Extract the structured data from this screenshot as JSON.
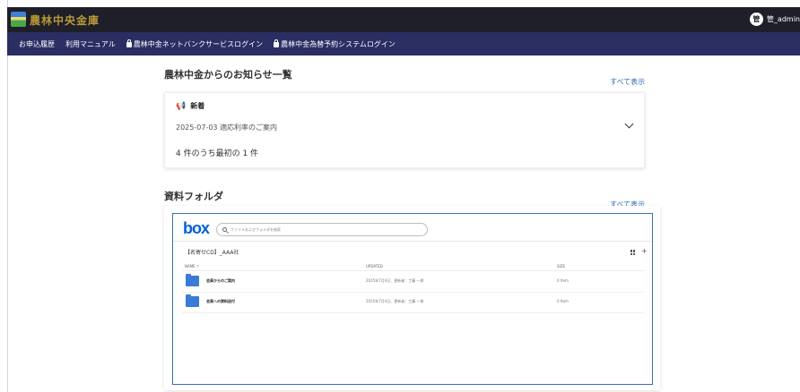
{
  "header": {
    "logo_text": "農林中央金庫",
    "user_initial": "管",
    "user_name": "管_admin"
  },
  "nav": {
    "items": [
      {
        "label": "お申込履歴"
      },
      {
        "label": "利用マニュアル"
      },
      {
        "label": "農林中金ネットバンクサービスログイン",
        "icon": "lock-icon"
      },
      {
        "label": "農林中金為替予約システムログイン",
        "icon": "lock-icon"
      }
    ]
  },
  "news": {
    "title": "農林中金からのお知らせ一覧",
    "see_all": "すべて表示",
    "heading": "新着",
    "item": "2025-07-03 適応利率のご案内",
    "count": "4 件のうち最初の 1 件"
  },
  "folders": {
    "title": "資料フォルダ",
    "see_all": "すべて表示",
    "box_logo": "box",
    "search_placeholder": "ファイルおよびフォルダを検索",
    "path": "【名寄せCD】_AAA社",
    "columns": {
      "name": "NAME ↑",
      "updated": "UPDATED",
      "size": "SIZE"
    },
    "rows": [
      {
        "name": "会員からのご案内",
        "updated": "2025年7月4日、更新者：工藤 一郎",
        "size": "0 Item"
      },
      {
        "name": "会員への資料送付",
        "updated": "2025年7月4日、更新者：工藤 一郎",
        "size": "0 Item"
      }
    ]
  },
  "colors": {
    "topbar": "#1f1f2a",
    "navbar": "#2b2e63",
    "logo_gold": "#b79a36",
    "link_blue": "#2d6ab8",
    "box_blue": "#0061d5",
    "folder_blue": "#3a7bd5"
  }
}
